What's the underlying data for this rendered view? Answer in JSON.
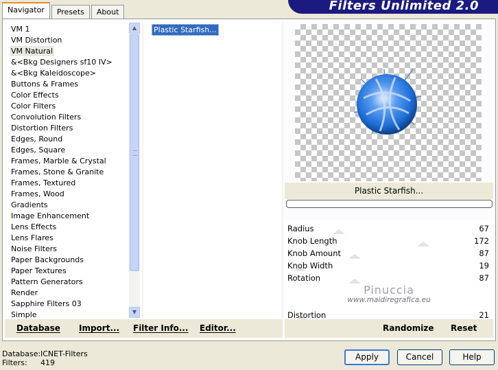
{
  "tabs": [
    {
      "label": "Navigator",
      "active": true
    },
    {
      "label": "Presets",
      "active": false
    },
    {
      "label": "About",
      "active": false
    }
  ],
  "banner": {
    "title": "Filters Unlimited 2.0"
  },
  "categories": {
    "selected": "VM Natural",
    "items": [
      "VM 1",
      "VM Distortion",
      "VM Natural",
      "&<Bkg Designers sf10 IV>",
      "&<Bkg Kaleidoscope>",
      "Buttons & Frames",
      "Color Effects",
      "Color Filters",
      "Convolution Filters",
      "Distortion Filters",
      "Edges, Round",
      "Edges, Square",
      "Frames, Marble & Crystal",
      "Frames, Stone & Granite",
      "Frames, Textured",
      "Frames, Wood",
      "Gradients",
      "Image Enhancement",
      "Lens Effects",
      "Lens Flares",
      "Noise Filters",
      "Paper Backgrounds",
      "Paper Textures",
      "Pattern Generators",
      "Render",
      "Sapphire Filters 03",
      "Simple"
    ]
  },
  "filters": {
    "items": [
      "Plastic Starfish..."
    ],
    "selected": "Plastic Starfish..."
  },
  "left_buttons": {
    "database": "Database",
    "import": "Import...",
    "filter_info": "Filter Info...",
    "editor": "Editor..."
  },
  "preview": {
    "filter_name": "Plastic Starfish..."
  },
  "params": [
    {
      "name": "Radius",
      "value": "67",
      "level": 67
    },
    {
      "name": "Knob Length",
      "value": "172",
      "level": 172
    },
    {
      "name": "Knob Amount",
      "value": "87",
      "level": 87
    },
    {
      "name": "Knob Width",
      "value": "19",
      "level": 19
    },
    {
      "name": "Rotation",
      "value": "87",
      "level": 87
    },
    {
      "name": "Distortion",
      "value": "21",
      "level": 21
    }
  ],
  "watermark": {
    "name": "Pinuccia",
    "url": "www.maidiregrafica.eu"
  },
  "right_buttons": {
    "randomize": "Randomize",
    "reset": "Reset"
  },
  "status": {
    "database_label": "Database:",
    "database_value": "ICNET-Filters",
    "filters_label": "Filters:",
    "filters_value": "419"
  },
  "dialog_buttons": {
    "apply": "Apply",
    "cancel": "Cancel",
    "help": "Help"
  },
  "colors": {
    "banner": "#1b1a80",
    "selection": "#316ac5",
    "sphere_blue": "#1e6fd9"
  }
}
